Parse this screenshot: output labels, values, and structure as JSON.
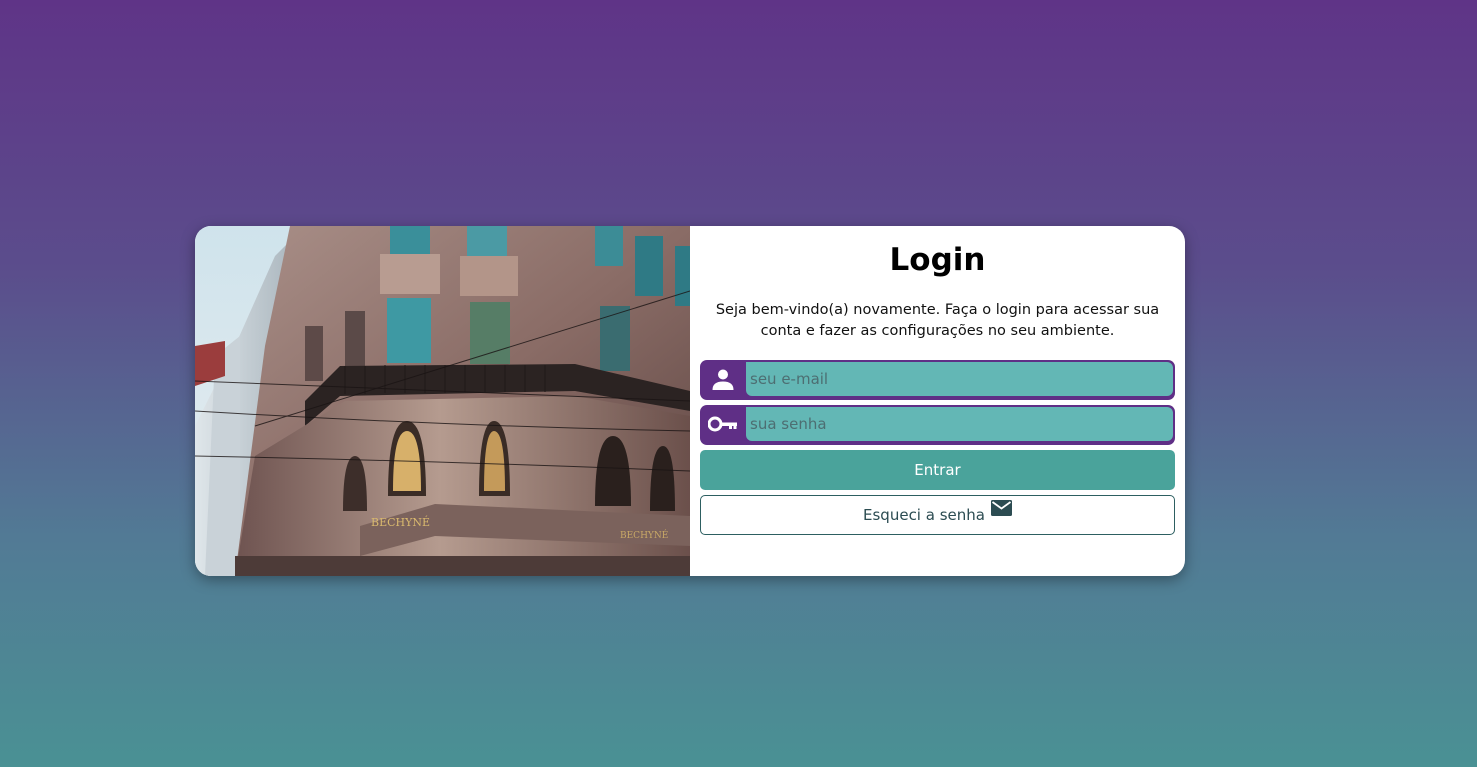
{
  "login": {
    "title": "Login",
    "subtitle": "Seja bem-vindo(a) novamente. Faça o login para acessar sua conta e fazer as configurações no seu ambiente.",
    "email": {
      "placeholder": "seu e-mail",
      "value": "",
      "icon": "user-icon"
    },
    "password": {
      "placeholder": "sua senha",
      "value": "",
      "icon": "key-icon"
    },
    "submit_label": "Entrar",
    "forgot_label": "Esqueci a senha",
    "forgot_icon": "mail-icon"
  },
  "image": {
    "sign_text": "BECHYNÉ",
    "sign_text_2": "BECHYNÉ"
  },
  "colors": {
    "accent_purple": "#5f2f86",
    "input_teal": "#63b7b5",
    "button_teal": "#4aa39b",
    "outline_dark_teal": "#2d5f61"
  }
}
